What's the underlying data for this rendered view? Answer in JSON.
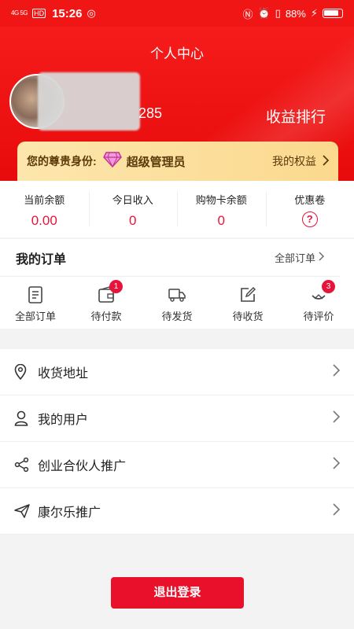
{
  "status_bar": {
    "network": "4G 5G",
    "hd": "HD",
    "time": "15:26",
    "battery": "88%"
  },
  "header": {
    "title": "个人中心",
    "user_id_suffix": "285",
    "rank_link": "收益排行"
  },
  "vip": {
    "label": "您的尊贵身份:",
    "level": "超级管理员",
    "benefits_link": "我的权益"
  },
  "stats": [
    {
      "title": "当前余额",
      "value": "0.00"
    },
    {
      "title": "今日收入",
      "value": "0"
    },
    {
      "title": "购物卡余额",
      "value": "0"
    },
    {
      "title": "优惠卷",
      "value": "?"
    }
  ],
  "orders": {
    "title": "我的订单",
    "all_link": "全部订单",
    "items": [
      {
        "label": "全部订单",
        "icon": "order-list-icon",
        "badge": ""
      },
      {
        "label": "待付款",
        "icon": "wallet-icon",
        "badge": "1"
      },
      {
        "label": "待发货",
        "icon": "truck-icon",
        "badge": ""
      },
      {
        "label": "待收货",
        "icon": "edit-box-icon",
        "badge": ""
      },
      {
        "label": "待评价",
        "icon": "review-icon",
        "badge": "3"
      }
    ]
  },
  "menu": [
    {
      "label": "收货地址",
      "icon": "location-pin-icon"
    },
    {
      "label": "我的用户",
      "icon": "user-icon"
    },
    {
      "label": "创业合伙人推广",
      "icon": "share-icon"
    },
    {
      "label": "康尔乐推广",
      "icon": "send-icon"
    }
  ],
  "logout_label": "退出登录",
  "colors": {
    "primary_red": "#f01616",
    "value_red": "#e8133a",
    "vip_gold": "#fbd98e"
  }
}
